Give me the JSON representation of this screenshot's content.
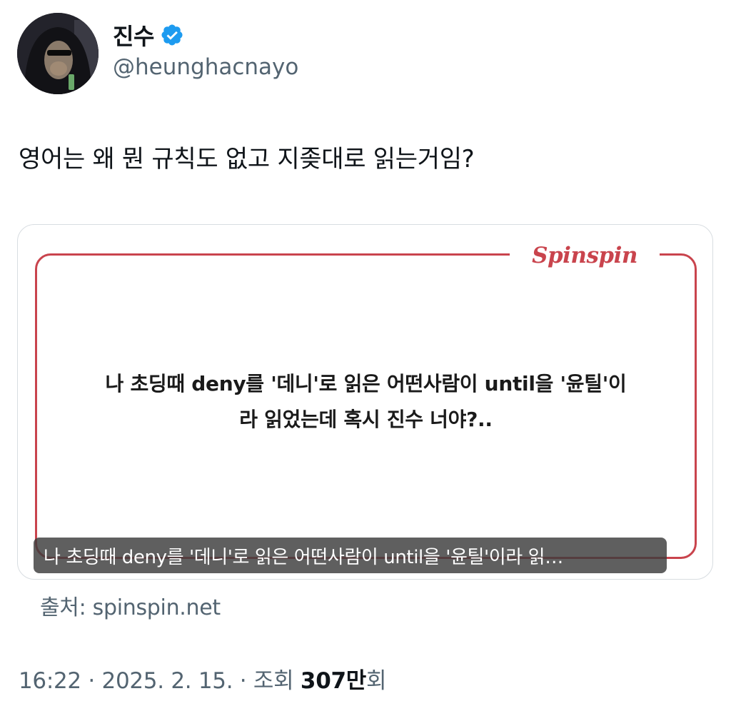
{
  "author": {
    "display_name": "진수",
    "handle": "@heunghacnayo",
    "avatar_icon": "avatar-hooded-figure-icon",
    "verified_icon": "verified-badge-icon",
    "verified_color": "#1d9bf0"
  },
  "tweet": {
    "text": "영어는 왜 뭔 규칙도 없고 지좆대로 읽는거임?"
  },
  "media": {
    "logo": "Spinspin",
    "frame_color": "#c9444d",
    "quote_line1": "나 초딩때 deny를 '데니'로 읽은 어떤사람이 until을 '윤틸'이",
    "quote_line2": "라 읽었는데 혹시 진수 너야?..",
    "caption": "나 초딩때 deny를 '데니'로 읽은 어떤사람이 until을 '윤틸'이라 읽…"
  },
  "source": {
    "label": "출처: spinspin.net"
  },
  "meta": {
    "time": "16:22",
    "separator": " · ",
    "date": "2025. 2. 15.",
    "views_label": "조회 ",
    "views_count": "307만",
    "views_suffix": "회"
  }
}
